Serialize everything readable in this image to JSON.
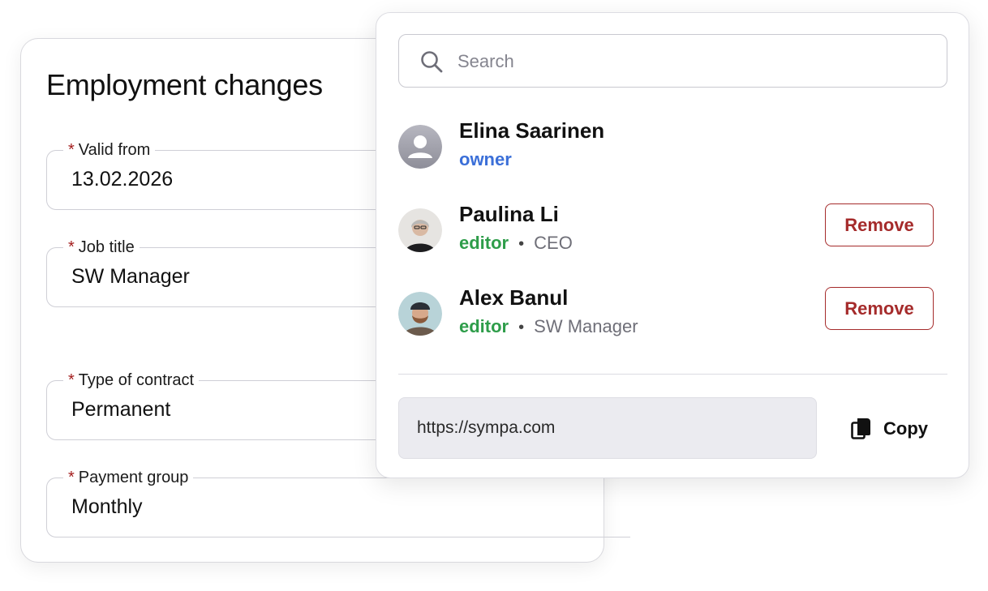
{
  "employment": {
    "title": "Employment changes",
    "required_marker": "*",
    "fields": [
      {
        "label": "Valid from",
        "value": "13.02.2026"
      },
      {
        "label": "Job title",
        "value": "SW Manager"
      },
      {
        "label": "Type of contract",
        "value": "Permanent"
      },
      {
        "label": "Payment group",
        "value": "Monthly"
      }
    ]
  },
  "share": {
    "search": {
      "placeholder": "Search",
      "value": ""
    },
    "separator": "•",
    "users": [
      {
        "name": "Elina Saarinen",
        "role": "owner",
        "title": "",
        "avatar": "default-avatar-icon",
        "removable": false
      },
      {
        "name": "Paulina Li",
        "role": "editor",
        "title": "CEO",
        "avatar": "photo-avatar",
        "removable": true,
        "remove_label": "Remove"
      },
      {
        "name": "Alex Banul",
        "role": "editor",
        "title": "SW Manager",
        "avatar": "photo-avatar",
        "removable": true,
        "remove_label": "Remove"
      }
    ],
    "link": {
      "url": "https://sympa.com",
      "copy_label": "Copy",
      "copy_icon": "copy-icon"
    }
  },
  "colors": {
    "owner_role": "#3b6fd8",
    "editor_role": "#2e9d4a",
    "remove": "#a52b2b",
    "required": "#a31d1d"
  }
}
